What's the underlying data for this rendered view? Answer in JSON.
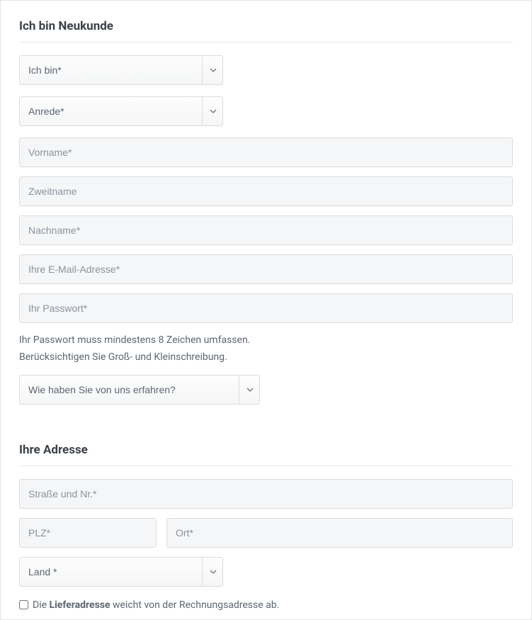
{
  "section1": {
    "title": "Ich bin Neukunde",
    "customer_type": {
      "selected": "Ich bin*"
    },
    "salutation": {
      "selected": "Anrede*"
    },
    "firstname": {
      "placeholder": "Vorname*"
    },
    "middlename": {
      "placeholder": "Zweitname"
    },
    "lastname": {
      "placeholder": "Nachname*"
    },
    "email": {
      "placeholder": "Ihre E-Mail-Adresse*"
    },
    "password": {
      "placeholder": "Ihr Passwort*"
    },
    "password_hint_line1": "Ihr Passwort muss mindestens 8 Zeichen umfassen.",
    "password_hint_line2": "Berücksichtigen Sie Groß- und Kleinschreibung.",
    "referral": {
      "selected": "Wie haben Sie von uns erfahren?"
    }
  },
  "section2": {
    "title": "Ihre Adresse",
    "street": {
      "placeholder": "Straße und Nr.*"
    },
    "zip": {
      "placeholder": "PLZ*"
    },
    "city": {
      "placeholder": "Ort*"
    },
    "country": {
      "selected": "Land *"
    },
    "shipping_diff_prefix": "Die ",
    "shipping_diff_bold": "Lieferadresse",
    "shipping_diff_suffix": " weicht von der Rechnungsadresse ab."
  }
}
